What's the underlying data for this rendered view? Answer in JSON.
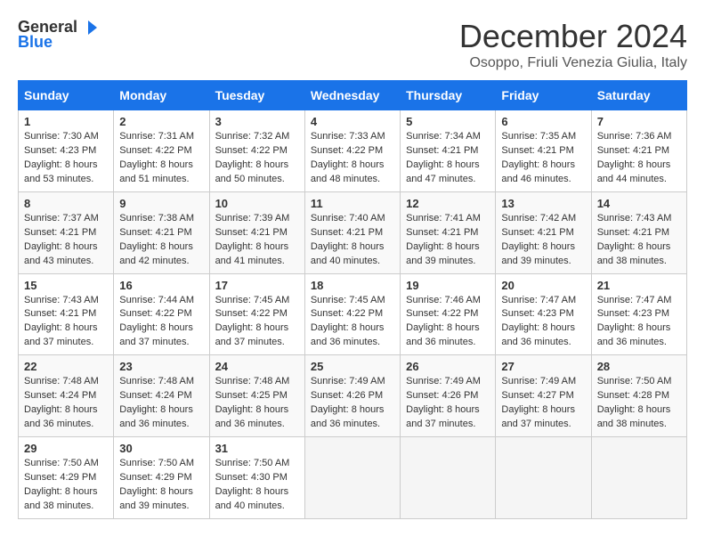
{
  "logo": {
    "line1": "General",
    "line2": "Blue"
  },
  "title": "December 2024",
  "location": "Osoppo, Friuli Venezia Giulia, Italy",
  "weekdays": [
    "Sunday",
    "Monday",
    "Tuesday",
    "Wednesday",
    "Thursday",
    "Friday",
    "Saturday"
  ],
  "weeks": [
    [
      {
        "day": "1",
        "sunrise": "7:30 AM",
        "sunset": "4:23 PM",
        "daylight": "8 hours and 53 minutes."
      },
      {
        "day": "2",
        "sunrise": "7:31 AM",
        "sunset": "4:22 PM",
        "daylight": "8 hours and 51 minutes."
      },
      {
        "day": "3",
        "sunrise": "7:32 AM",
        "sunset": "4:22 PM",
        "daylight": "8 hours and 50 minutes."
      },
      {
        "day": "4",
        "sunrise": "7:33 AM",
        "sunset": "4:22 PM",
        "daylight": "8 hours and 48 minutes."
      },
      {
        "day": "5",
        "sunrise": "7:34 AM",
        "sunset": "4:21 PM",
        "daylight": "8 hours and 47 minutes."
      },
      {
        "day": "6",
        "sunrise": "7:35 AM",
        "sunset": "4:21 PM",
        "daylight": "8 hours and 46 minutes."
      },
      {
        "day": "7",
        "sunrise": "7:36 AM",
        "sunset": "4:21 PM",
        "daylight": "8 hours and 44 minutes."
      }
    ],
    [
      {
        "day": "8",
        "sunrise": "7:37 AM",
        "sunset": "4:21 PM",
        "daylight": "8 hours and 43 minutes."
      },
      {
        "day": "9",
        "sunrise": "7:38 AM",
        "sunset": "4:21 PM",
        "daylight": "8 hours and 42 minutes."
      },
      {
        "day": "10",
        "sunrise": "7:39 AM",
        "sunset": "4:21 PM",
        "daylight": "8 hours and 41 minutes."
      },
      {
        "day": "11",
        "sunrise": "7:40 AM",
        "sunset": "4:21 PM",
        "daylight": "8 hours and 40 minutes."
      },
      {
        "day": "12",
        "sunrise": "7:41 AM",
        "sunset": "4:21 PM",
        "daylight": "8 hours and 39 minutes."
      },
      {
        "day": "13",
        "sunrise": "7:42 AM",
        "sunset": "4:21 PM",
        "daylight": "8 hours and 39 minutes."
      },
      {
        "day": "14",
        "sunrise": "7:43 AM",
        "sunset": "4:21 PM",
        "daylight": "8 hours and 38 minutes."
      }
    ],
    [
      {
        "day": "15",
        "sunrise": "7:43 AM",
        "sunset": "4:21 PM",
        "daylight": "8 hours and 37 minutes."
      },
      {
        "day": "16",
        "sunrise": "7:44 AM",
        "sunset": "4:22 PM",
        "daylight": "8 hours and 37 minutes."
      },
      {
        "day": "17",
        "sunrise": "7:45 AM",
        "sunset": "4:22 PM",
        "daylight": "8 hours and 37 minutes."
      },
      {
        "day": "18",
        "sunrise": "7:45 AM",
        "sunset": "4:22 PM",
        "daylight": "8 hours and 36 minutes."
      },
      {
        "day": "19",
        "sunrise": "7:46 AM",
        "sunset": "4:22 PM",
        "daylight": "8 hours and 36 minutes."
      },
      {
        "day": "20",
        "sunrise": "7:47 AM",
        "sunset": "4:23 PM",
        "daylight": "8 hours and 36 minutes."
      },
      {
        "day": "21",
        "sunrise": "7:47 AM",
        "sunset": "4:23 PM",
        "daylight": "8 hours and 36 minutes."
      }
    ],
    [
      {
        "day": "22",
        "sunrise": "7:48 AM",
        "sunset": "4:24 PM",
        "daylight": "8 hours and 36 minutes."
      },
      {
        "day": "23",
        "sunrise": "7:48 AM",
        "sunset": "4:24 PM",
        "daylight": "8 hours and 36 minutes."
      },
      {
        "day": "24",
        "sunrise": "7:48 AM",
        "sunset": "4:25 PM",
        "daylight": "8 hours and 36 minutes."
      },
      {
        "day": "25",
        "sunrise": "7:49 AM",
        "sunset": "4:26 PM",
        "daylight": "8 hours and 36 minutes."
      },
      {
        "day": "26",
        "sunrise": "7:49 AM",
        "sunset": "4:26 PM",
        "daylight": "8 hours and 37 minutes."
      },
      {
        "day": "27",
        "sunrise": "7:49 AM",
        "sunset": "4:27 PM",
        "daylight": "8 hours and 37 minutes."
      },
      {
        "day": "28",
        "sunrise": "7:50 AM",
        "sunset": "4:28 PM",
        "daylight": "8 hours and 38 minutes."
      }
    ],
    [
      {
        "day": "29",
        "sunrise": "7:50 AM",
        "sunset": "4:29 PM",
        "daylight": "8 hours and 38 minutes."
      },
      {
        "day": "30",
        "sunrise": "7:50 AM",
        "sunset": "4:29 PM",
        "daylight": "8 hours and 39 minutes."
      },
      {
        "day": "31",
        "sunrise": "7:50 AM",
        "sunset": "4:30 PM",
        "daylight": "8 hours and 40 minutes."
      },
      null,
      null,
      null,
      null
    ]
  ]
}
